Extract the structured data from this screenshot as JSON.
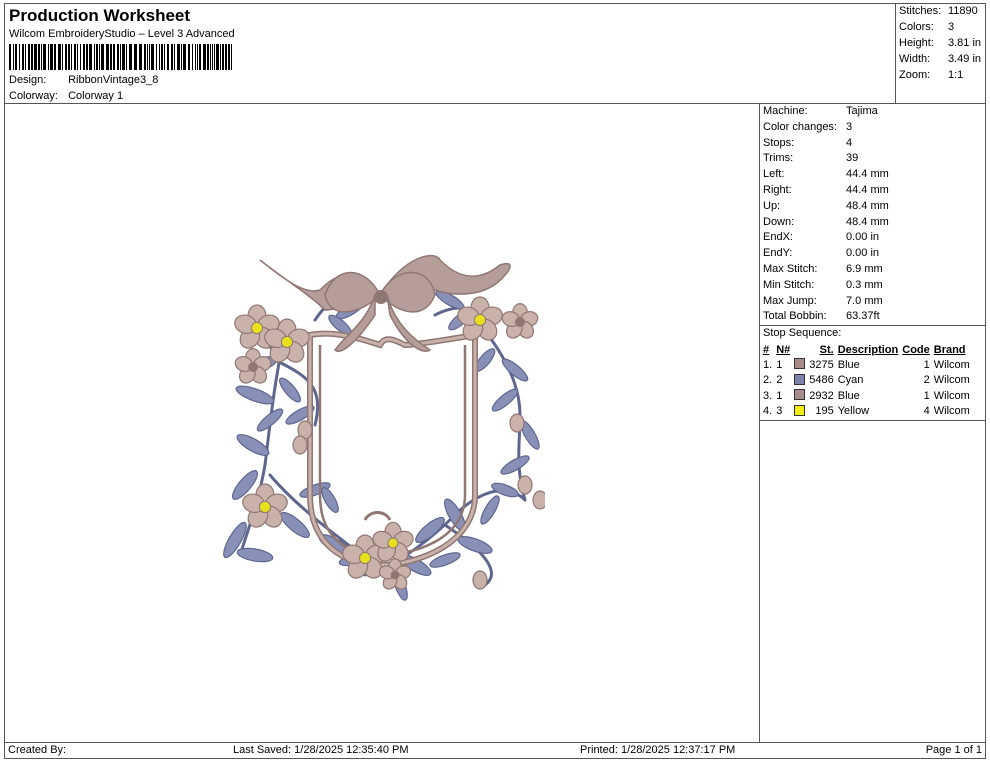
{
  "header": {
    "title": "Production Worksheet",
    "subtitle": "Wilcom EmbroideryStudio – Level 3 Advanced",
    "design_label": "Design:",
    "design_value": "RibbonVintage3_8",
    "colorway_label": "Colorway:",
    "colorway_value": "Colorway 1"
  },
  "summary": [
    {
      "label": "Stitches:",
      "value": "11890"
    },
    {
      "label": "Colors:",
      "value": "3"
    },
    {
      "label": "Height:",
      "value": "3.81 in"
    },
    {
      "label": "Width:",
      "value": "3.49 in"
    },
    {
      "label": "Zoom:",
      "value": "1:1"
    }
  ],
  "machine": [
    {
      "label": "Machine:",
      "value": "Tajima"
    },
    {
      "label": "Color changes:",
      "value": "3"
    },
    {
      "label": "Stops:",
      "value": "4"
    },
    {
      "label": "Trims:",
      "value": "39"
    },
    {
      "label": "Left:",
      "value": "44.4 mm"
    },
    {
      "label": "Right:",
      "value": "44.4 mm"
    },
    {
      "label": "Up:",
      "value": "48.4 mm"
    },
    {
      "label": "Down:",
      "value": "48.4 mm"
    },
    {
      "label": "EndX:",
      "value": "0.00 in"
    },
    {
      "label": "EndY:",
      "value": "0.00 in"
    },
    {
      "label": "Max Stitch:",
      "value": "6.9 mm"
    },
    {
      "label": "Min Stitch:",
      "value": "0.3 mm"
    },
    {
      "label": "Max Jump:",
      "value": "7.0 mm"
    },
    {
      "label": "Total Bobbin:",
      "value": "63.37ft"
    }
  ],
  "stop_sequence": {
    "title": "Stop Sequence:",
    "columns": [
      "#",
      "N#",
      "St.",
      "Description",
      "Code",
      "Brand"
    ],
    "rows": [
      {
        "num": "1.",
        "n": "1",
        "color": "#a88c8c",
        "st": "3275",
        "desc": "Blue",
        "code": "1",
        "brand": "Wilcom"
      },
      {
        "num": "2.",
        "n": "2",
        "color": "#7c82ac",
        "st": "5486",
        "desc": "Cyan",
        "code": "2",
        "brand": "Wilcom"
      },
      {
        "num": "3.",
        "n": "1",
        "color": "#a88c8c",
        "st": "2932",
        "desc": "Blue",
        "code": "1",
        "brand": "Wilcom"
      },
      {
        "num": "4.",
        "n": "3",
        "color": "#f2ec14",
        "st": "195",
        "desc": "Yellow",
        "code": "4",
        "brand": "Wilcom"
      }
    ]
  },
  "footer": {
    "created_by": "Created By:",
    "last_saved": "Last Saved: 1/28/2025 12:35:40 PM",
    "printed": "Printed: 1/28/2025 12:37:17 PM",
    "page": "Page 1 of 1"
  },
  "colors": {
    "ribbon": "#b59e9a",
    "ribbon_dark": "#8f7773",
    "leaf": "#8890b8",
    "leaf_dark": "#5f668e",
    "flower": "#c9b2aa",
    "center": "#e8e01c"
  }
}
